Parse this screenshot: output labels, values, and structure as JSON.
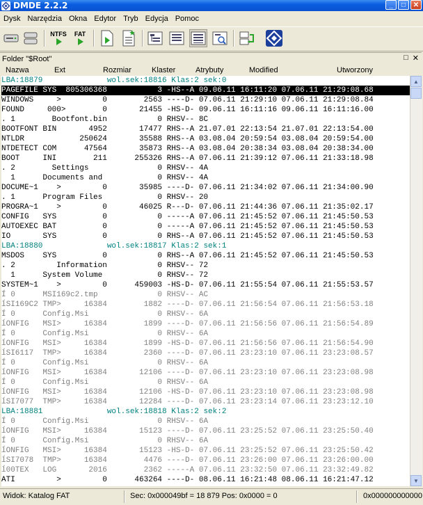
{
  "app": {
    "title": "DMDE 2.2.2"
  },
  "window_buttons": {
    "minimize": "_",
    "maximize": "□",
    "close": "✕"
  },
  "menu": [
    "Dysk",
    "Narzędzia",
    "Okna",
    "Edytor",
    "Tryb",
    "Edycja",
    "Pomoc"
  ],
  "toolbar": {
    "ntfs_label": "NTFS",
    "fat_label": "FAT"
  },
  "folder": {
    "title": "Folder \"$Root\"",
    "restore_icon": "□",
    "close_icon": "✕"
  },
  "columns": {
    "name": "Nazwa",
    "ext": "Ext",
    "size": "Rozmiar",
    "cluster": "Klaster",
    "attrs": "Atrybuty",
    "modified": "Modified",
    "created": "Utworzony"
  },
  "rows": [
    {
      "text": "LBA:18879              wol.sek:18816 Klas:2 sek:0",
      "style": "teal"
    },
    {
      "text": "PAGEFILE SYS  805306368           3 -HS--A 09.06.11 16:11:20 07.06.11 21:29:08.68",
      "style": "sel"
    },
    {
      "text": "WINDOWS     >         0        2563 ----D- 07.06.11 21:29:10 07.06.11 21:29:08.84",
      "style": ""
    },
    {
      "text": "FOUND     000>        0       21455 -HS-D- 09.06.11 16:11:16 09.06.11 16:11:16.00",
      "style": ""
    },
    {
      "text": ". 1        Bootfont.bin           0 RHSV-- 8C",
      "style": ""
    },
    {
      "text": "BOOTFONT BIN       4952       17477 RHS--A 21.07.01 22:13:54 21.07.01 22:13:54.00",
      "style": ""
    },
    {
      "text": "NTLDR            250624       35588 RHS--A 03.08.04 20:59:54 03.08.04 20:59:54.00",
      "style": ""
    },
    {
      "text": "NTDETECT COM      47564       35873 RHS--A 03.08.04 20:38:34 03.08.04 20:38:34.00",
      "style": ""
    },
    {
      "text": "BOOT     INI        211      255326 RHS--A 07.06.11 21:39:12 07.06.11 21:33:18.98",
      "style": ""
    },
    {
      "text": ". 2        Settings               0 RHSV-- 4A",
      "style": ""
    },
    {
      "text": "  1      Documents and            0 RHSV-- 4A",
      "style": ""
    },
    {
      "text": "DOCUME~1    >         0       35985 ----D- 07.06.11 21:34:02 07.06.11 21:34:00.90",
      "style": ""
    },
    {
      "text": ". 1      Program Files            0 RHSV-- 20",
      "style": ""
    },
    {
      "text": "PROGRA~1    >         0       46025 R---D- 07.06.11 21:44:36 07.06.11 21:35:02.17",
      "style": ""
    },
    {
      "text": "CONFIG   SYS          0           0 -----A 07.06.11 21:45:52 07.06.11 21:45:50.53",
      "style": ""
    },
    {
      "text": "AUTOEXEC BAT          0           0 -----A 07.06.11 21:45:52 07.06.11 21:45:50.53",
      "style": ""
    },
    {
      "text": "IO       SYS          0           0 RHS--A 07.06.11 21:45:52 07.06.11 21:45:50.53",
      "style": ""
    },
    {
      "text": "LBA:18880              wol.sek:18817 Klas:2 sek:1",
      "style": "teal"
    },
    {
      "text": "MSDOS    SYS          0           0 RHS--A 07.06.11 21:45:52 07.06.11 21:45:50.53",
      "style": ""
    },
    {
      "text": ". 2         Information           0 RHSV-- 72",
      "style": ""
    },
    {
      "text": "  1      System Volume            0 RHSV-- 72",
      "style": ""
    },
    {
      "text": "SYSTEM~1    >         0      459003 -HS-D- 07.06.11 21:55:54 07.06.11 21:55:53.57",
      "style": ""
    },
    {
      "text": "Í 0      MSI169c2.tmp             0 RHSV-- AC",
      "style": "gray"
    },
    {
      "text": "ĺSI169C2 TMP>     16384        1882 ----D- 07.06.11 21:56:54 07.06.11 21:56:53.18",
      "style": "gray"
    },
    {
      "text": "Í 0      Config.Msi               0 RHSV-- 6A",
      "style": "gray"
    },
    {
      "text": "ĺONFIG   MSI>     16384        1899 ----D- 07.06.11 21:56:56 07.06.11 21:56:54.89",
      "style": "gray"
    },
    {
      "text": "Í 0      Config.Msi               0 RHSV-- 6A",
      "style": "gray"
    },
    {
      "text": "ĺONFIG   MSI>     16384        1899 -HS-D- 07.06.11 21:56:56 07.06.11 21:56:54.90",
      "style": "gray"
    },
    {
      "text": "ĺSI6117  TMP>     16384        2360 ----D- 07.06.11 23:23:10 07.06.11 23:23:08.57",
      "style": "gray"
    },
    {
      "text": "Í 0      Config.Msi               0 RHSV-- 6A",
      "style": "gray"
    },
    {
      "text": "ĺONFIG   MSI>     16384       12106 ----D- 07.06.11 23:23:10 07.06.11 23:23:08.98",
      "style": "gray"
    },
    {
      "text": "Í 0      Config.Msi               0 RHSV-- 6A",
      "style": "gray"
    },
    {
      "text": "ĺONFIG   MSI>     16384       12106 -HS-D- 07.06.11 23:23:10 07.06.11 23:23:08.98",
      "style": "gray"
    },
    {
      "text": "ĺSI7077  TMP>     16384       12284 ----D- 07.06.11 23:23:14 07.06.11 23:23:12.10",
      "style": "gray"
    },
    {
      "text": "LBA:18881              wol.sek:18818 Klas:2 sek:2",
      "style": "teal"
    },
    {
      "text": "Í 0      Config.Msi               0 RHSV-- 6A",
      "style": "gray"
    },
    {
      "text": "ĺONFIG   MSI>     16384       15123 ----D- 07.06.11 23:25:52 07.06.11 23:25:50.40",
      "style": "gray"
    },
    {
      "text": "Í 0      Config.Msi               0 RHSV-- 6A",
      "style": "gray"
    },
    {
      "text": "ĺONFIG   MSI>     16384       15123 -HS-D- 07.06.11 23:25:52 07.06.11 23:25:50.42",
      "style": "gray"
    },
    {
      "text": "ĺSI7078  TMP>     16384        4476 ----D- 07.06.11 23:26:00 07.06.11 23:26:00.00",
      "style": "gray"
    },
    {
      "text": "ĺ00TEX   LOG       2016        2362 -----A 07.06.11 23:32:50 07.06.11 23:32:49.82",
      "style": "gray"
    },
    {
      "text": "ATI         >         0      463264 ----D- 08.06.11 16:21:48 08.06.11 16:21:47.12",
      "style": ""
    }
  ],
  "status": {
    "left": "Widok: Katalog FAT",
    "mid": "Sec: 0x000049bf = 18 879  Pos: 0x0000 = 0",
    "right": "0x000000000000"
  }
}
